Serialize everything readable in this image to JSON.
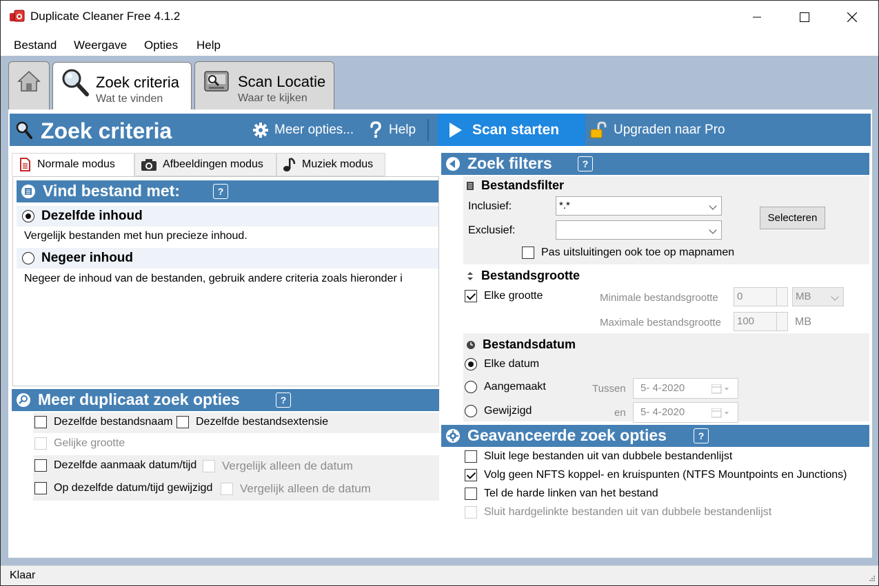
{
  "window": {
    "title": "Duplicate Cleaner Free 4.1.2",
    "controls": {
      "minimize": "minimize",
      "maximize": "maximize",
      "close": "close"
    }
  },
  "menu": [
    "Bestand",
    "Weergave",
    "Opties",
    "Help"
  ],
  "top_tabs": {
    "home_icon": "home-icon",
    "zoek": {
      "title": "Zoek criteria",
      "subtitle": "Wat te vinden"
    },
    "scan": {
      "title": "Scan Locatie",
      "subtitle": "Waar te kijken"
    }
  },
  "header": {
    "title": "Zoek criteria",
    "more_options": "Meer opties...",
    "help": "Help",
    "scan_start": "Scan starten",
    "upgrade": "Upgraden naar Pro"
  },
  "mode_tabs": [
    "Normale modus",
    "Afbeeldingen modus",
    "Muziek modus"
  ],
  "find_section": {
    "title": "Vind bestand met:",
    "help": "?",
    "options": [
      {
        "label": "Dezelfde inhoud",
        "desc": "Vergelijk bestanden met hun precieze inhoud.",
        "selected": true
      },
      {
        "label": "Negeer inhoud",
        "desc": "Negeer de inhoud van de bestanden, gebruik andere criteria zoals hieronder i",
        "selected": false
      }
    ]
  },
  "more_dup_section": {
    "title": "Meer duplicaat zoek opties",
    "help": "?",
    "same_name": "Dezelfde bestandsnaam",
    "same_ext": "Dezelfde bestandsextensie",
    "same_size": "Gelijke grootte",
    "same_created": "Dezelfde aanmaak datum/tijd",
    "compare_date_only_1": "Vergelijk alleen de datum",
    "same_modified": "Op dezelfde datum/tijd gewijzigd",
    "compare_date_only_2": "Vergelijk alleen de datum"
  },
  "filters_section": {
    "title": "Zoek filters",
    "help": "?",
    "file_filter": {
      "title": "Bestandsfilter",
      "include_label": "Inclusief:",
      "include_value": "*.*",
      "exclude_label": "Exclusief:",
      "exclude_value": "",
      "select_button": "Selecteren",
      "apply_to_folders": "Pas uitsluitingen ook toe op mapnamen",
      "apply_to_folders_checked": false
    },
    "file_size": {
      "title": "Bestandsgrootte",
      "any_size": "Elke grootte",
      "any_size_checked": true,
      "min_label": "Minimale bestandsgrootte",
      "min_value": "0",
      "min_unit": "MB",
      "max_label": "Maximale bestandsgrootte",
      "max_value": "100",
      "max_unit": "MB"
    },
    "file_date": {
      "title": "Bestandsdatum",
      "any_date": "Elke datum",
      "created": "Aangemaakt",
      "created_between": "Tussen",
      "created_date": "5-  4-2020",
      "modified": "Gewijzigd",
      "modified_and": "en",
      "modified_date": "5-  4-2020",
      "selected": "any_date"
    }
  },
  "advanced_section": {
    "title": "Geavanceerde zoek opties",
    "help": "?",
    "items": [
      {
        "label": "Sluit lege bestanden uit van dubbele bestandenlijst",
        "checked": false,
        "enabled": true
      },
      {
        "label": "Volg geen NFTS koppel- en kruispunten (NTFS Mountpoints en Junctions)",
        "checked": true,
        "enabled": true
      },
      {
        "label": "Tel de harde linken van het bestand",
        "checked": false,
        "enabled": true
      },
      {
        "label": "Sluit hardgelinkte bestanden uit van dubbele bestandenlijst",
        "checked": false,
        "enabled": false
      }
    ]
  },
  "status": {
    "text": "Klaar"
  },
  "colors": {
    "header_blue": "#4580b4",
    "scan_blue": "#1e87e0",
    "window_bg": "#aebed3"
  }
}
